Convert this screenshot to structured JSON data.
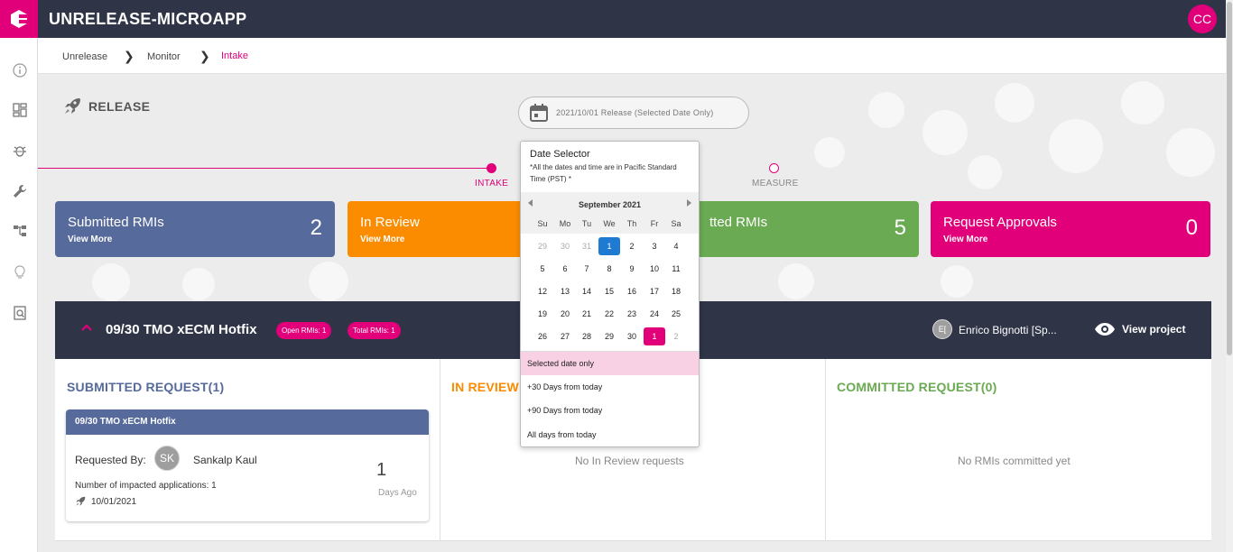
{
  "header": {
    "app_title": "UNRELEASE-MICROAPP",
    "avatar_initials": "CC"
  },
  "breadcrumb": {
    "items": [
      "Unrelease",
      "Monitor",
      "Intake"
    ]
  },
  "release": {
    "label": "RELEASE",
    "date_pill": "2021/10/01 Release (Selected Date Only)"
  },
  "steps": {
    "intake": "INTAKE",
    "measure": "MEASURE"
  },
  "stats": [
    {
      "title": "Submitted RMIs",
      "link": "View More",
      "value": "2",
      "color": "#566a9b"
    },
    {
      "title": "In Review",
      "link": "View More",
      "value": "",
      "color": "#fb8c00"
    },
    {
      "title": "tted RMIs",
      "link": "",
      "value": "5",
      "color": "#6aaa52"
    },
    {
      "title": "Request Approvals",
      "link": "View More",
      "value": "0",
      "color": "#e2007a"
    }
  ],
  "project": {
    "title": "09/30 TMO xECM Hotfix",
    "open_badge": "Open RMIs: 1",
    "total_badge": "Total RMIs: 1",
    "owner_initials": "E[",
    "owner_name": "Enrico Bignotti [Sp...",
    "view_project": "View project"
  },
  "columns": {
    "submitted_title": "SUBMITTED REQUEST(1)",
    "review_title": "IN REVIEW",
    "committed_title": "COMMITTED REQUEST(0)",
    "review_empty": "No In Review requests",
    "committed_empty": "No RMIs committed yet"
  },
  "request_card": {
    "title": "09/30 TMO xECM Hotfix",
    "requested_by_label": "Requested By:",
    "requester_initials": "SK",
    "requester_name": "Sankalp Kaul",
    "impacted": "Number of impacted applications: 1",
    "date": "10/01/2021",
    "days_num": "1",
    "days_label": "Days Ago"
  },
  "date_selector": {
    "title": "Date Selector",
    "note": "*All the dates and time are in Pacific Standard Time (PST) *",
    "month": "September 2021",
    "dow": [
      "Su",
      "Mo",
      "Tu",
      "We",
      "Th",
      "Fr",
      "Sa"
    ],
    "weeks": [
      [
        "29",
        "30",
        "31",
        "1",
        "2",
        "3",
        "4"
      ],
      [
        "5",
        "6",
        "7",
        "8",
        "9",
        "10",
        "11"
      ],
      [
        "12",
        "13",
        "14",
        "15",
        "16",
        "17",
        "18"
      ],
      [
        "19",
        "20",
        "21",
        "22",
        "23",
        "24",
        "25"
      ],
      [
        "26",
        "27",
        "28",
        "29",
        "30",
        "1",
        "2"
      ]
    ],
    "options": [
      "Selected date only",
      "+30 Days from today",
      "+90 Days from today",
      "All days from today"
    ]
  },
  "colors": {
    "brand_pink": "#e2007a",
    "header_navy": "#2f3447",
    "submitted_blue": "#566a9b",
    "review_orange": "#fb8c00",
    "committed_green": "#6aaa52"
  }
}
